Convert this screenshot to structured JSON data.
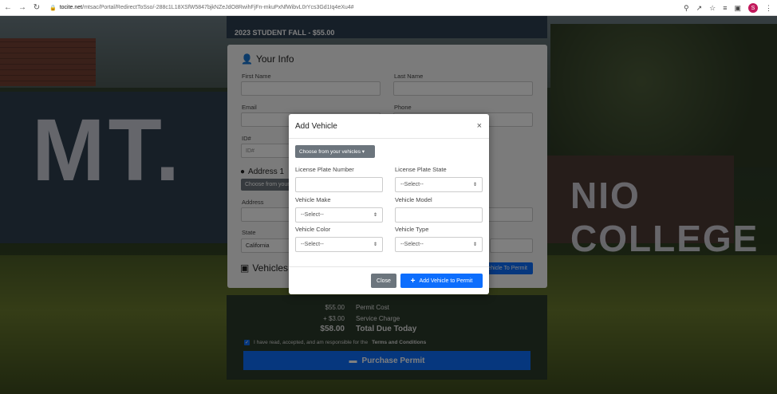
{
  "browser": {
    "url_domain": "tocite.net",
    "url_path": "/mtsac/Portal/RedirectToSso/-288c1L18XSfW5847bjkNZeJdO8RwihFjFn-mkuPxNfWibvL0rYcs3Gd1Iq4eXu4#",
    "profile_initial": "S"
  },
  "page": {
    "permit_title": "2023 STUDENT FALL - $55.00",
    "your_info_title": "Your Info",
    "first_name_label": "First Name",
    "last_name_label": "Last Name",
    "email_label": "Email",
    "phone_label": "Phone",
    "id_label": "ID#",
    "id_placeholder": "ID#",
    "address1_title": "Address 1",
    "choose_address": "Choose from your",
    "address_label": "Address",
    "state_label": "State",
    "state_value": "California",
    "vehicles_title": "Vehicles",
    "add_vehicle_to_permit_btn": "Vehicle To Permit"
  },
  "summary": {
    "permit_cost_amount": "$55.00",
    "permit_cost_label": "Permit Cost",
    "service_amount": "+ $3.00",
    "service_label": "Service Charge",
    "total_amount": "$58.00",
    "total_label": "Total Due Today",
    "terms_text": "I have read, accepted, and am responsible for the",
    "terms_link": "Terms and Conditions",
    "purchase_label": "Purchase Permit"
  },
  "modal": {
    "title": "Add Vehicle",
    "close_icon": "×",
    "choose_vehicles": "Choose from your vehicles",
    "plate_number_label": "License Plate Number",
    "plate_state_label": "License Plate State",
    "plate_state_value": "--Select--",
    "make_label": "Vehicle Make",
    "make_value": "--Select--",
    "model_label": "Vehicle Model",
    "color_label": "Vehicle Color",
    "color_value": "--Select--",
    "type_label": "Vehicle Type",
    "type_value": "--Select--",
    "close_button": "Close",
    "add_button": "Add Vehicle to Permit"
  },
  "colors": {
    "primary": "#0d6efd",
    "secondary": "#6c757d"
  }
}
